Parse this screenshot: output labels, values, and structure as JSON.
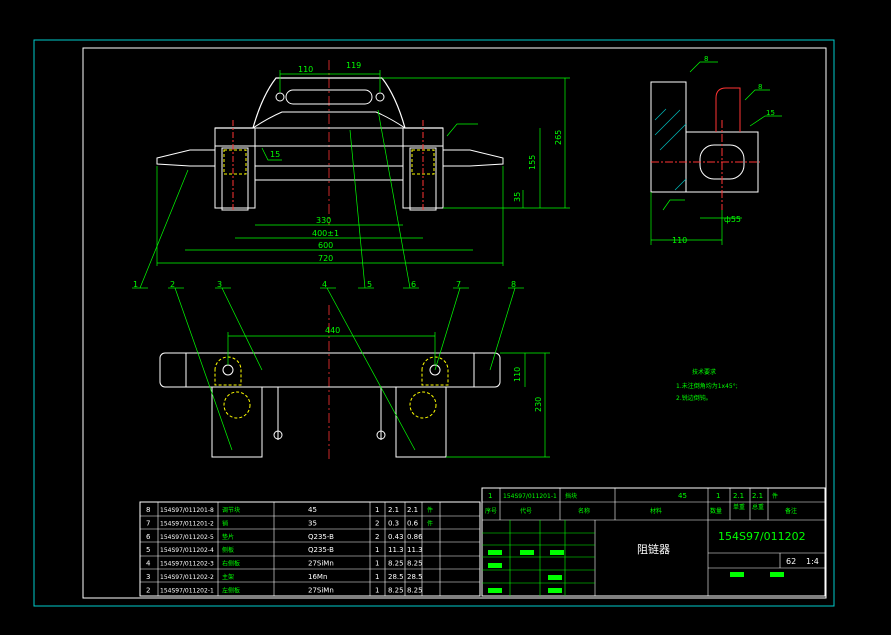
{
  "colors": {
    "background": "#000000",
    "frame": "#00cccc",
    "outline": "#ffffff",
    "dimension": "#00ff00",
    "center_line": "#ff3333",
    "hidden": "#ffff00",
    "hatch": "#00bbbb"
  },
  "front_view": {
    "dims": [
      "110",
      "119",
      "330",
      "400±1",
      "600",
      "720",
      "155",
      "35",
      "265"
    ],
    "surface": "15"
  },
  "side_view": {
    "dims": [
      "110",
      "ф55"
    ],
    "roughness": [
      "8",
      "8",
      "15"
    ]
  },
  "top_view": {
    "dims": [
      "440",
      "110",
      "230"
    ]
  },
  "balloons": [
    "1",
    "2",
    "3",
    "4",
    "5",
    "6",
    "7",
    "8"
  ],
  "notes": {
    "title": "技术要求",
    "line1": "1.未注倒角均为1x45°;",
    "line2": "2.锐边倒钝。"
  },
  "parts": [
    {
      "no": "8",
      "code": "154S97/011201-8",
      "name": "调节块",
      "material": "45",
      "qty": "1",
      "unit_wt": "2.1",
      "total_wt": "2.1",
      "note": "件"
    },
    {
      "no": "7",
      "code": "154S97/011201-2",
      "name": "销",
      "material": "35",
      "qty": "2",
      "unit_wt": "0.3",
      "total_wt": "0.6",
      "note": "件"
    },
    {
      "no": "6",
      "code": "154S97/011202-5",
      "name": "垫片",
      "material": "Q235-B",
      "qty": "2",
      "unit_wt": "0.43",
      "total_wt": "0.86",
      "note": ""
    },
    {
      "no": "5",
      "code": "154S97/011202-4",
      "name": "侧板",
      "material": "Q235-B",
      "qty": "1",
      "unit_wt": "11.3",
      "total_wt": "11.3",
      "note": ""
    },
    {
      "no": "4",
      "code": "154S97/011202-3",
      "name": "右侧板",
      "material": "27SiMn",
      "qty": "1",
      "unit_wt": "8.25",
      "total_wt": "8.25",
      "note": ""
    },
    {
      "no": "3",
      "code": "154S97/011202-2",
      "name": "主架",
      "material": "16Mn",
      "qty": "1",
      "unit_wt": "28.5",
      "total_wt": "28.5",
      "note": ""
    },
    {
      "no": "2",
      "code": "154S97/011202-1",
      "name": "左侧板",
      "material": "27SiMn",
      "qty": "1",
      "unit_wt": "8.25",
      "total_wt": "8.25",
      "note": ""
    }
  ],
  "parts_header_row": {
    "no": "1",
    "code": "154S97/011201-1",
    "name": "挡块",
    "material": "45",
    "qty": "1",
    "unit_wt": "2.1",
    "total_wt": "2.1",
    "note": "件"
  },
  "column_headers": {
    "no": "序号",
    "code": "代号",
    "name": "名称",
    "material": "材料",
    "qty": "数量",
    "weight": "单重",
    "total": "总重",
    "note": "备注"
  },
  "title_block": {
    "title": "阻链器",
    "drawing_no": "154S97/011202",
    "weight": "62",
    "scale": "1:4"
  }
}
